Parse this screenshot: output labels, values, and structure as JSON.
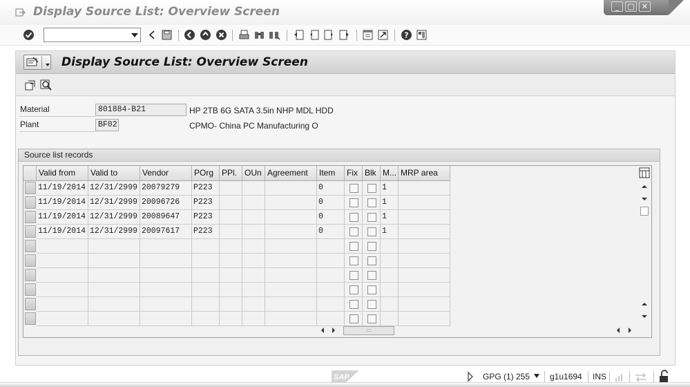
{
  "window": {
    "title": "Display Source List: Overview Screen"
  },
  "toolbar": {
    "command_value": "",
    "icons": [
      "enter-icon",
      "back-icon",
      "save-icon",
      "exit-icon",
      "cancel-icon",
      "print-icon",
      "find-icon",
      "find-next-icon",
      "first-page-icon",
      "prev-page-icon",
      "next-page-icon",
      "last-page-icon",
      "create-session-icon",
      "shortcut-icon",
      "help-icon",
      "layout-icon"
    ]
  },
  "screen": {
    "title": "Display Source List: Overview Screen",
    "app_icons": [
      "choose-icon",
      "details-icon"
    ]
  },
  "header": {
    "material_label": "Material",
    "material_value": "801884-B21",
    "material_desc": "HP 2TB 6G SATA 3.5in NHP MDL HDD",
    "plant_label": "Plant",
    "plant_value": "BF02",
    "plant_desc": "CPMO- China PC Manufacturing O"
  },
  "records": {
    "group_title": "Source list records",
    "columns": [
      "Valid from",
      "Valid to",
      "Vendor",
      "POrg",
      "PPl.",
      "OUn",
      "Agreement",
      "Item",
      "Fix",
      "Blk",
      "M...",
      "MRP area"
    ],
    "rows": [
      {
        "valid_from": "11/19/2014",
        "valid_to": "12/31/2999",
        "vendor": "20079279",
        "porg": "P223",
        "ppl": "",
        "oun": "",
        "agreement": "",
        "item": "0",
        "fix": false,
        "blk": false,
        "m": "1",
        "mrp_area": ""
      },
      {
        "valid_from": "11/19/2014",
        "valid_to": "12/31/2999",
        "vendor": "20096726",
        "porg": "P223",
        "ppl": "",
        "oun": "",
        "agreement": "",
        "item": "0",
        "fix": false,
        "blk": false,
        "m": "1",
        "mrp_area": ""
      },
      {
        "valid_from": "11/19/2014",
        "valid_to": "12/31/2999",
        "vendor": "20089647",
        "porg": "P223",
        "ppl": "",
        "oun": "",
        "agreement": "",
        "item": "0",
        "fix": false,
        "blk": false,
        "m": "1",
        "mrp_area": ""
      },
      {
        "valid_from": "11/19/2014",
        "valid_to": "12/31/2999",
        "vendor": "20097617",
        "porg": "P223",
        "ppl": "",
        "oun": "",
        "agreement": "",
        "item": "0",
        "fix": false,
        "blk": false,
        "m": "1",
        "mrp_area": ""
      }
    ],
    "empty_rows": 6
  },
  "status": {
    "system": "GPG (1) 255",
    "server": "g1u1694",
    "mode": "INS",
    "logo": "SAP"
  }
}
